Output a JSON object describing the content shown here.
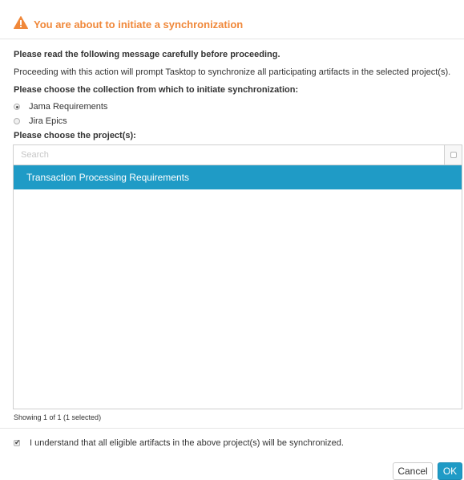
{
  "dialog": {
    "title": "You are about to initiate a synchronization",
    "warning_icon": "warning-triangle-icon",
    "accent_color": "#f0883a"
  },
  "intro": {
    "heading": "Please read the following message carefully before proceeding.",
    "message": "Proceeding with this action will prompt Tasktop to synchronize all participating artifacts in the selected project(s)."
  },
  "collection": {
    "heading": "Please choose the collection from which to initiate synchronization:",
    "options": [
      {
        "label": "Jama Requirements",
        "selected": true
      },
      {
        "label": "Jira Epics",
        "selected": false
      }
    ]
  },
  "projects": {
    "heading": "Please choose the project(s):",
    "search_placeholder": "Search",
    "items": [
      {
        "label": "Transaction Processing Requirements",
        "selected": true
      }
    ],
    "selection_color": "#1f9bc6",
    "status": "Showing 1 of 1 (1 selected)"
  },
  "confirm": {
    "label": "I understand that all eligible artifacts in the above project(s) will be synchronized.",
    "checked": true
  },
  "buttons": {
    "cancel": "Cancel",
    "ok": "OK"
  }
}
